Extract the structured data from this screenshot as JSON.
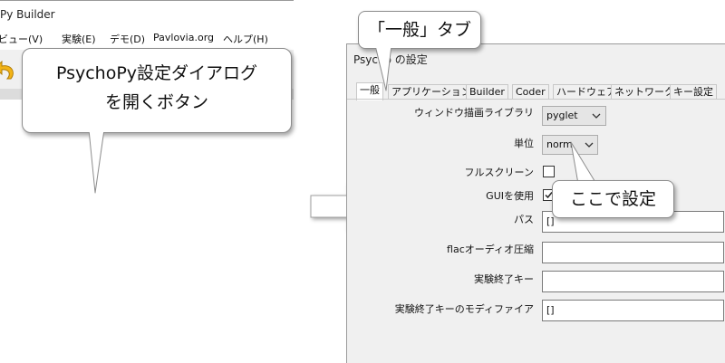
{
  "builder": {
    "title": "Py Builder",
    "menu": [
      {
        "label": "ビュー(V)"
      },
      {
        "label": "実験(E)"
      },
      {
        "label": "デモ(D)"
      },
      {
        "label": "Pavlovia.org"
      },
      {
        "label": "ヘルプ(H)"
      }
    ],
    "toolbar": {
      "icons": [
        "undo-icon",
        "redo-icon",
        "preferences-icon",
        "monitor-center-icon",
        "compile-icon",
        "edit-icon",
        "run-icon",
        "stop-icon"
      ]
    }
  },
  "callouts": {
    "left_line1": "PsychoPy設定ダイアログ",
    "left_line2": "を開くボタン",
    "tab": "「一般」タブ",
    "setting": "ここで設定"
  },
  "prefs": {
    "title": "Psycho  の設定",
    "tabs": [
      {
        "label": "一般",
        "active": true
      },
      {
        "label": "アプリケーション",
        "active": false
      },
      {
        "label": "Builder",
        "active": false
      },
      {
        "label": "Coder",
        "active": false
      },
      {
        "label": "ハードウェア",
        "active": false
      },
      {
        "label": "ネットワーク",
        "active": false
      },
      {
        "label": "キー設定",
        "active": false
      }
    ],
    "fields": {
      "window_lib": {
        "label": "ウィンドウ描画ライブラリ",
        "value": "pyglet"
      },
      "units": {
        "label": "単位",
        "value": "norm"
      },
      "fullscreen": {
        "label": "フルスクリーン",
        "checked": false
      },
      "gui": {
        "label": "GUIを使用",
        "checked": true
      },
      "path": {
        "label": "パス",
        "value": "[]"
      },
      "flac": {
        "label": "flacオーディオ圧縮",
        "value": ""
      },
      "quit_key": {
        "label": "実験終了キー",
        "value": ""
      },
      "quit_key_mod": {
        "label": "実験終了キーのモディファイア",
        "value": "[]"
      }
    }
  },
  "colors": {
    "accent_blue": "#3a78c8",
    "run_green": "#2ea02e",
    "stop_dark": "#333333"
  }
}
